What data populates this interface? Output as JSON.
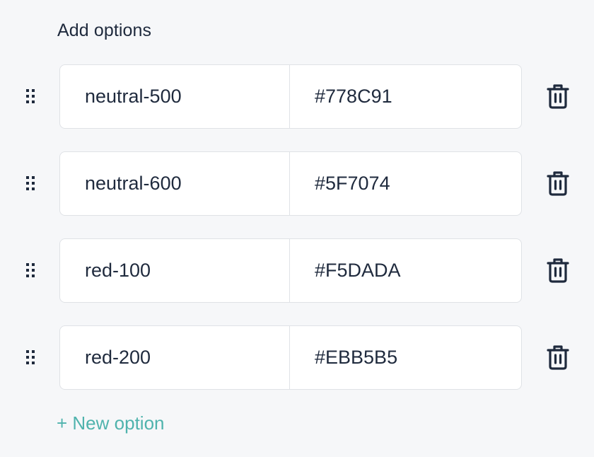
{
  "title": "Add options",
  "options": [
    {
      "name": "neutral-500",
      "value": "#778C91"
    },
    {
      "name": "neutral-600",
      "value": "#5F7074"
    },
    {
      "name": "red-100",
      "value": "#F5DADA"
    },
    {
      "name": "red-200",
      "value": "#EBB5B5"
    }
  ],
  "new_option_label": "+ New option",
  "icons": {
    "drag": "drag-handle-icon",
    "delete": "trash-icon"
  },
  "colors": {
    "accent": "#4FB3AD",
    "text": "#1F2A3D",
    "border": "#DFE2E6",
    "background": "#F6F7F9"
  }
}
